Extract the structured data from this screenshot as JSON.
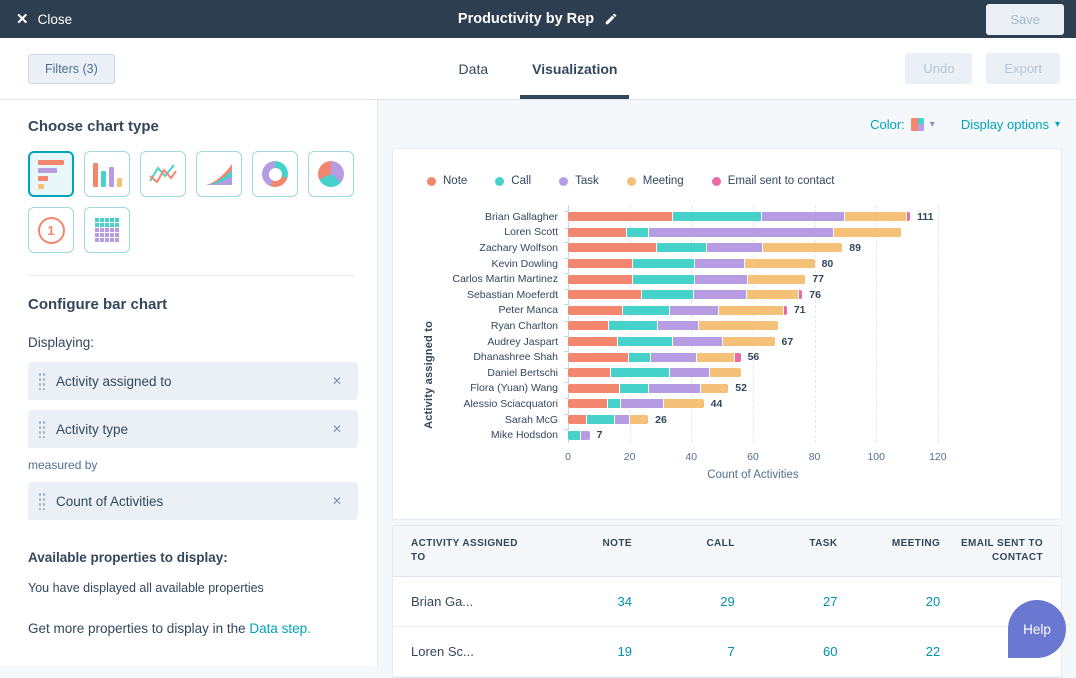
{
  "top_bar": {
    "close_label": "Close",
    "title": "Productivity by Rep",
    "save_label": "Save"
  },
  "toolbar": {
    "filters_label": "Filters (3)",
    "tabs": [
      {
        "label": "Data"
      },
      {
        "label": "Visualization"
      }
    ],
    "undo_label": "Undo",
    "export_label": "Export"
  },
  "sidebar": {
    "chart_type_heading": "Choose chart type",
    "kpi_icon_label": "1",
    "configure_heading": "Configure bar chart",
    "displaying_label": "Displaying:",
    "displaying_fields": [
      "Activity assigned to",
      "Activity type"
    ],
    "measured_by_label": "measured by",
    "measure_field": "Count of Activities",
    "available_heading": "Available properties to display:",
    "available_note": "You have displayed all available properties",
    "more_text": "Get more properties to display in the ",
    "more_link": "Data step."
  },
  "main_options": {
    "color_label": "Color:",
    "display_options_label": "Display options"
  },
  "chart_data": {
    "type": "bar",
    "orientation": "horizontal-stacked",
    "xlabel": "Count of Activities",
    "ylabel": "Activity assigned to",
    "x_ticks": [
      0,
      20,
      40,
      60,
      80,
      100,
      120
    ],
    "x_max": 134,
    "grid": "vertical-dashed",
    "legend_position": "top",
    "categories": [
      "Brian Gallagher",
      "Loren Scott",
      "Zachary Wolfson",
      "Kevin Dowling",
      "Carlos Martin Martinez",
      "Sebastian Moeferdt",
      "Peter Manca",
      "Ryan Charlton",
      "Audrey Jaspart",
      "Dhanashree Shah",
      "Daniel Bertschi",
      "Flora (Yuan) Wang",
      "Alessio Sciacquatori",
      "Sarah McG",
      "Mike Hodsdon"
    ],
    "series": [
      {
        "name": "Note",
        "color": "#f3866e",
        "values": [
          34,
          19,
          29,
          21,
          21,
          24,
          18,
          13,
          16,
          20,
          14,
          17,
          13,
          6,
          0
        ]
      },
      {
        "name": "Call",
        "color": "#47d1cb",
        "values": [
          29,
          7,
          16,
          20,
          20,
          17,
          15,
          16,
          18,
          7,
          19,
          9,
          4,
          9,
          4
        ]
      },
      {
        "name": "Task",
        "color": "#b59ce3",
        "values": [
          27,
          60,
          18,
          16,
          17,
          17,
          16,
          13,
          16,
          15,
          13,
          17,
          14,
          5,
          3
        ]
      },
      {
        "name": "Meeting",
        "color": "#f5c078",
        "values": [
          20,
          22,
          26,
          23,
          19,
          17,
          21,
          26,
          17,
          12,
          10,
          9,
          13,
          6,
          0
        ]
      },
      {
        "name": "Email sent to contact",
        "color": "#e86ba4",
        "values": [
          1,
          0,
          0,
          0,
          0,
          1,
          1,
          0,
          0,
          2,
          0,
          0,
          0,
          0,
          0
        ]
      }
    ],
    "total_labels": [
      "111",
      "",
      "89",
      "80",
      "77",
      "76",
      "71",
      "",
      "67",
      "56",
      "",
      "52",
      "44",
      "26",
      "7"
    ]
  },
  "table": {
    "headers": [
      "ACTIVITY ASSIGNED TO",
      "NOTE",
      "CALL",
      "TASK",
      "MEETING",
      "EMAIL SENT TO CONTACT"
    ],
    "rows": [
      {
        "name": "Brian Ga...",
        "values": [
          "34",
          "29",
          "27",
          "20",
          ""
        ]
      },
      {
        "name": "Loren Sc...",
        "values": [
          "19",
          "7",
          "60",
          "22",
          ""
        ]
      }
    ]
  },
  "help_label": "Help",
  "colors": {
    "top_bar": "#2d3e50",
    "accent_link": "#00a4bd",
    "heading": "#33475b",
    "table_value_link": "#0091ae",
    "help_button": "#6a78d2",
    "note": "#f3866e",
    "call": "#47d1cb",
    "task": "#b59ce3",
    "meeting": "#f5c078",
    "email": "#e86ba4"
  }
}
